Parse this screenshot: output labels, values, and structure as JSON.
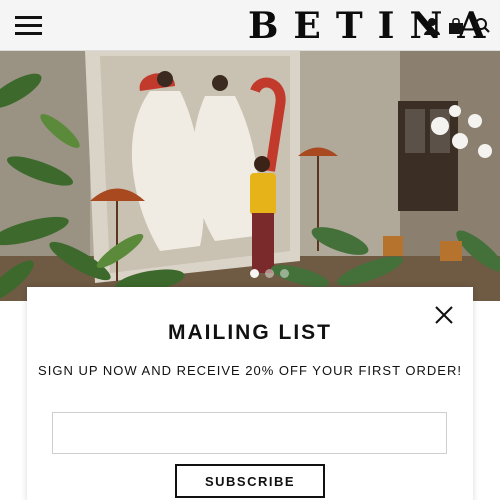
{
  "header": {
    "brand_name": "BETINA",
    "menu_icon": "hamburger-menu-icon",
    "account_icon": "user-icon",
    "cart_icon": "shopping-bag-icon",
    "search_icon": "search-icon",
    "background_color": "#f5f5f5"
  },
  "hero": {
    "slides_count": 3,
    "active_slide": 1
  },
  "mailing_popup": {
    "title": "MAILING LIST",
    "subtitle": "SIGN UP NOW AND RECEIVE 20% OFF YOUR FIRST ORDER!",
    "email_value": "",
    "email_placeholder": "",
    "subscribe_label": "SUBSCRIBE",
    "close_icon": "close-icon"
  }
}
